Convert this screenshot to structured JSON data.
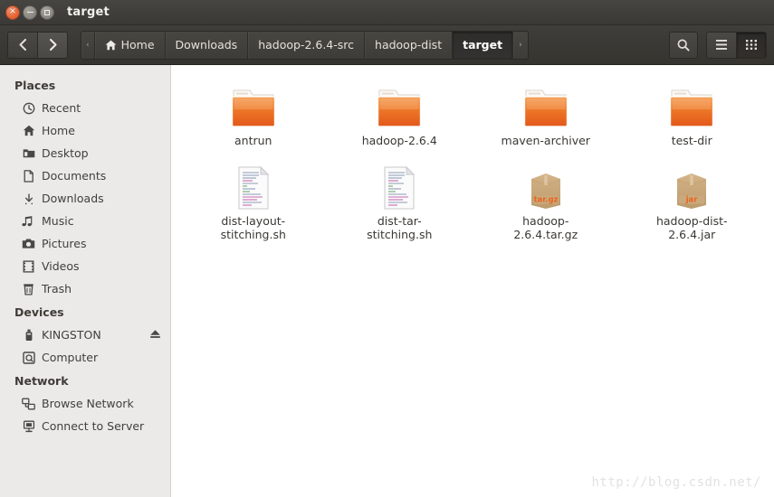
{
  "window": {
    "title": "target",
    "controls": {
      "close_label": "×",
      "minimize_label": "−",
      "maximize_label": "□"
    }
  },
  "toolbar": {
    "back_label": "‹",
    "forward_label": "›",
    "back_icon": "chevron-left-icon",
    "forward_icon": "chevron-right-icon",
    "search_icon": "search-icon",
    "list_view_icon": "list-view-icon",
    "grid_view_icon": "grid-view-icon",
    "leading_nub": "‹",
    "trailing_nub": "›",
    "breadcrumbs": [
      {
        "label": "Home",
        "icon": "home-icon",
        "active": false
      },
      {
        "label": "Downloads",
        "icon": "",
        "active": false
      },
      {
        "label": "hadoop-2.6.4-src",
        "icon": "",
        "active": false
      },
      {
        "label": "hadoop-dist",
        "icon": "",
        "active": false
      },
      {
        "label": "target",
        "icon": "",
        "active": true
      }
    ]
  },
  "sidebar": {
    "sections": [
      {
        "heading": "Places",
        "items": [
          {
            "label": "Recent",
            "icon": "clock-icon"
          },
          {
            "label": "Home",
            "icon": "home-icon"
          },
          {
            "label": "Desktop",
            "icon": "desktop-folder-icon"
          },
          {
            "label": "Documents",
            "icon": "document-icon"
          },
          {
            "label": "Downloads",
            "icon": "download-arrow-icon"
          },
          {
            "label": "Music",
            "icon": "music-note-icon"
          },
          {
            "label": "Pictures",
            "icon": "camera-icon"
          },
          {
            "label": "Videos",
            "icon": "film-icon"
          },
          {
            "label": "Trash",
            "icon": "trash-icon"
          }
        ]
      },
      {
        "heading": "Devices",
        "items": [
          {
            "label": "KINGSTON",
            "icon": "usb-drive-icon",
            "eject": true
          },
          {
            "label": "Computer",
            "icon": "hard-drive-icon"
          }
        ]
      },
      {
        "heading": "Network",
        "items": [
          {
            "label": "Browse Network",
            "icon": "network-icon"
          },
          {
            "label": "Connect to Server",
            "icon": "server-icon"
          }
        ]
      }
    ]
  },
  "files": [
    {
      "name": "antrun",
      "type": "folder",
      "badge": ""
    },
    {
      "name": "hadoop-2.6.4",
      "type": "folder",
      "badge": ""
    },
    {
      "name": "maven-archiver",
      "type": "folder",
      "badge": ""
    },
    {
      "name": "test-dir",
      "type": "folder",
      "badge": ""
    },
    {
      "name": "dist-layout-stitching.sh",
      "type": "script",
      "badge": ""
    },
    {
      "name": "dist-tar-stitching.sh",
      "type": "script",
      "badge": ""
    },
    {
      "name": "hadoop-2.6.4.tar.gz",
      "type": "archive",
      "badge": "tar.gz"
    },
    {
      "name": "hadoop-dist-2.6.4.jar",
      "type": "archive",
      "badge": "jar"
    }
  ],
  "watermark": "http://blog.csdn.net/",
  "colors": {
    "titlebar": "#3b3935",
    "toolbar": "#3a3833",
    "sidebar_bg": "#ebeae8",
    "content_bg": "#ffffff",
    "folder_orange": "#e8661f",
    "archive_tan": "#c5a477",
    "close_button": "#e8683a",
    "text_dark": "#3a3835",
    "text_light": "#e4e1dc"
  }
}
